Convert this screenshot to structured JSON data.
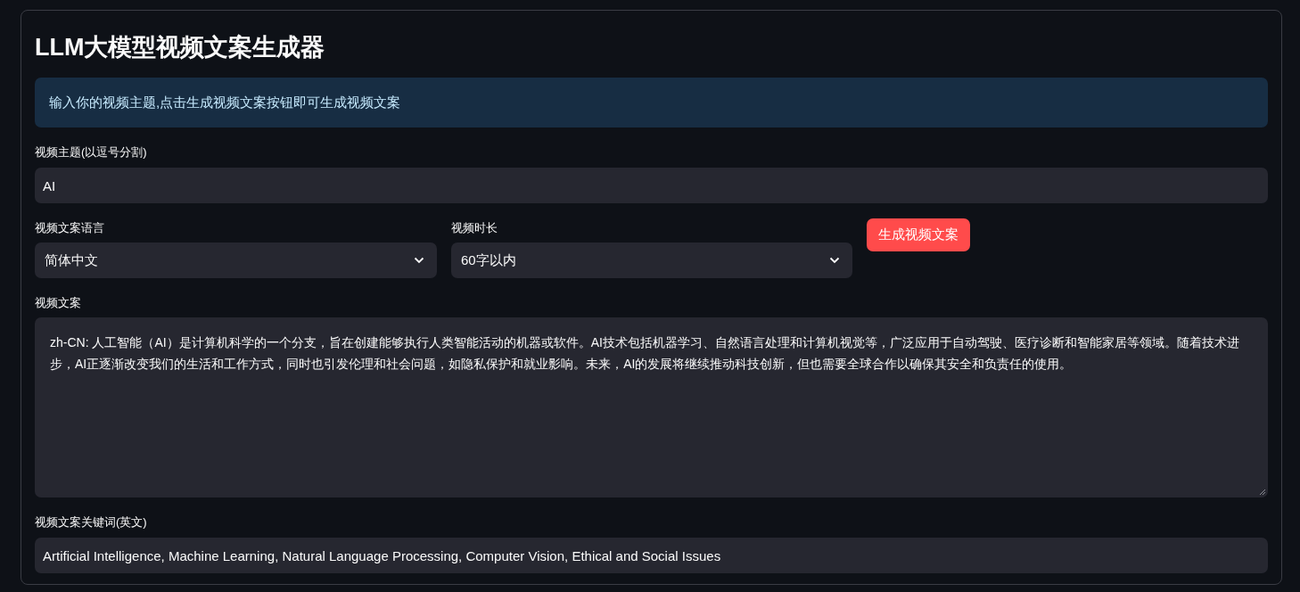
{
  "title": "LLM大模型视频文案生成器",
  "info_message": "输入你的视频主题,点击生成视频文案按钮即可生成视频文案",
  "topic_field": {
    "label": "视频主题(以逗号分割)",
    "value": "AI"
  },
  "selects": [
    {
      "label": "视频文案语言",
      "value": "简体中文"
    },
    {
      "label": "视频时长",
      "value": "60字以内"
    }
  ],
  "generate_button": "生成视频文案",
  "script_area": {
    "label": "视频文案",
    "value": "zh-CN: 人工智能（AI）是计算机科学的一个分支，旨在创建能够执行人类智能活动的机器或软件。AI技术包括机器学习、自然语言处理和计算机视觉等，广泛应用于自动驾驶、医疗诊断和智能家居等领域。随着技术进步，AI正逐渐改变我们的生活和工作方式，同时也引发伦理和社会问题，如隐私保护和就业影响。未来，AI的发展将继续推动科技创新，但也需要全球合作以确保其安全和负责任的使用。"
  },
  "keywords_field": {
    "label": "视频文案关键词(英文)",
    "value": "Artificial Intelligence, Machine Learning, Natural Language Processing, Computer Vision, Ethical and Social Issues"
  }
}
